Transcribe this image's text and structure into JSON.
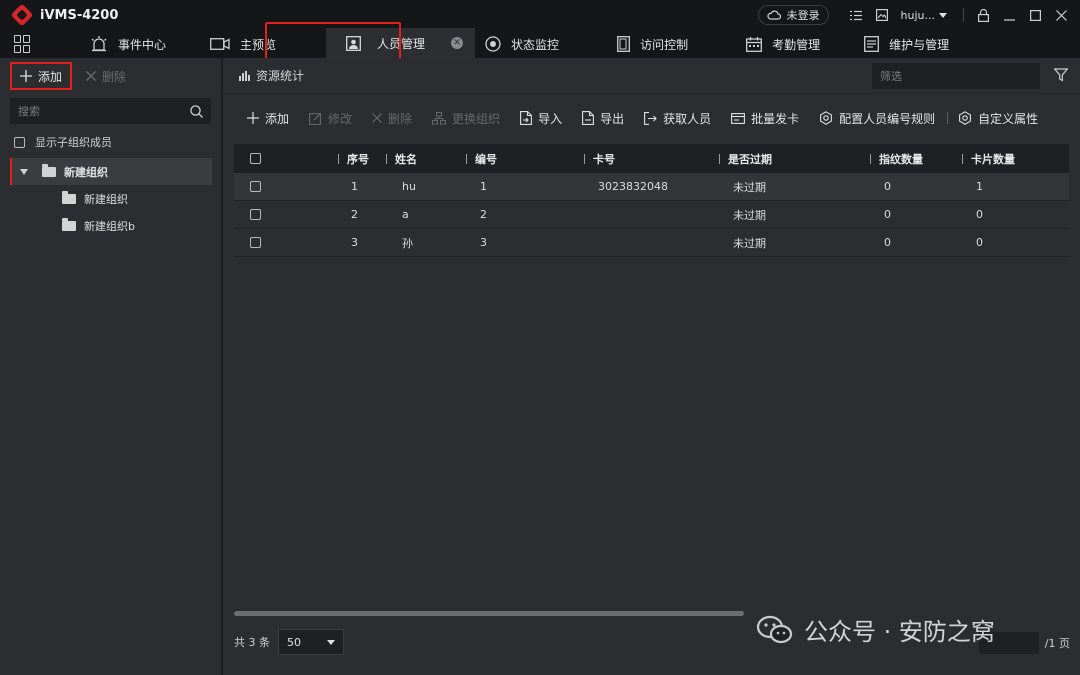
{
  "app": {
    "title": "iVMS-4200"
  },
  "titlebar": {
    "login_label": "未登录",
    "user_name": "huju..."
  },
  "nav": {
    "items": [
      {
        "label": "事件中心",
        "icon": "alarm-icon"
      },
      {
        "label": "主预览",
        "icon": "camera-icon"
      },
      {
        "label": "人员管理",
        "icon": "person-card-icon",
        "active": true
      },
      {
        "label": "状态监控",
        "icon": "monitor-dial-icon"
      },
      {
        "label": "访问控制",
        "icon": "door-icon"
      },
      {
        "label": "考勤管理",
        "icon": "calendar-icon"
      },
      {
        "label": "维护与管理",
        "icon": "maintenance-icon"
      }
    ]
  },
  "left": {
    "add_label": "添加",
    "delete_label": "删除",
    "search_placeholder": "搜索",
    "show_sub_members": "显示子组织成员",
    "tree": {
      "root": "新建组织",
      "children": [
        "新建组织",
        "新建组织b"
      ]
    }
  },
  "main": {
    "header_title": "资源统计",
    "filter_placeholder": "筛选",
    "toolbar": {
      "add": "添加",
      "edit": "修改",
      "delete": "删除",
      "change_org": "更换组织",
      "import": "导入",
      "export": "导出",
      "get_person": "获取人员",
      "batch_card": "批量发卡",
      "config_rule": "配置人员编号规则",
      "custom_attr": "自定义属性"
    },
    "table": {
      "columns": [
        "序号",
        "姓名",
        "编号",
        "卡号",
        "是否过期",
        "指纹数量",
        "卡片数量"
      ],
      "rows": [
        {
          "index": "1",
          "name": "hu",
          "id": "1",
          "card": "3023832048",
          "expired": "未过期",
          "fingerprints": "0",
          "cards": "1"
        },
        {
          "index": "2",
          "name": "a",
          "id": "2",
          "card": "",
          "expired": "未过期",
          "fingerprints": "0",
          "cards": "0"
        },
        {
          "index": "3",
          "name": "孙",
          "id": "3",
          "card": "",
          "expired": "未过期",
          "fingerprints": "0",
          "cards": "0"
        }
      ]
    },
    "footer": {
      "total_label": "共 3 条",
      "page_size": "50",
      "page_suffix": "/1 页"
    }
  },
  "watermark": {
    "text": "公众号 · 安防之窝"
  },
  "colors": {
    "accent_red": "#e3201b",
    "bg_dark": "#151618",
    "panel": "#2b2d30"
  }
}
